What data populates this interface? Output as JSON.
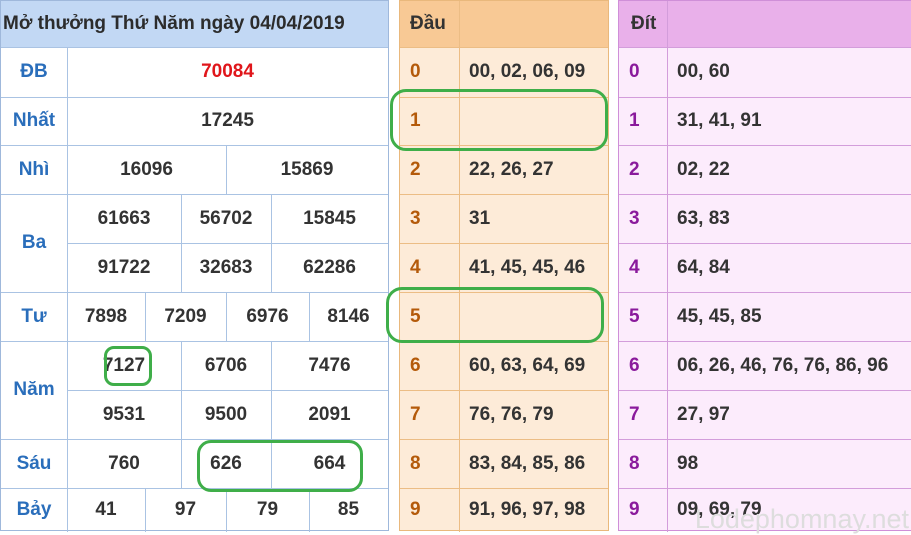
{
  "results": {
    "title": "Mở thưởng Thứ Năm ngày 04/04/2019",
    "rows": [
      {
        "label": "ĐB",
        "values": [
          "70084"
        ]
      },
      {
        "label": "Nhất",
        "values": [
          "17245"
        ]
      },
      {
        "label": "Nhì",
        "values": [
          "16096",
          "15869"
        ]
      },
      {
        "label": "Ba",
        "values": [
          "61663",
          "56702",
          "15845",
          "91722",
          "32683",
          "62286"
        ]
      },
      {
        "label": "Tư",
        "values": [
          "7898",
          "7209",
          "6976",
          "8146"
        ]
      },
      {
        "label": "Năm",
        "values": [
          "7127",
          "6706",
          "7476",
          "9531",
          "9500",
          "2091"
        ]
      },
      {
        "label": "Sáu",
        "values": [
          "760",
          "626",
          "664"
        ]
      },
      {
        "label": "Bảy",
        "values": [
          "41",
          "97",
          "79",
          "85"
        ]
      }
    ],
    "special_color": "#e0161b",
    "label_color": "#2a6ebb"
  },
  "dau": {
    "header": "Đầu",
    "rows": [
      {
        "digit": "0",
        "values": "00, 02, 06, 09"
      },
      {
        "digit": "1",
        "values": ""
      },
      {
        "digit": "2",
        "values": "22, 26, 27"
      },
      {
        "digit": "3",
        "values": "31"
      },
      {
        "digit": "4",
        "values": "41, 45, 45, 46"
      },
      {
        "digit": "5",
        "values": ""
      },
      {
        "digit": "6",
        "values": "60, 63, 64, 69"
      },
      {
        "digit": "7",
        "values": "76, 76, 79"
      },
      {
        "digit": "8",
        "values": "83, 84, 85, 86"
      },
      {
        "digit": "9",
        "values": "91, 96, 97, 98"
      }
    ],
    "digit_color": "#b45a0a"
  },
  "dit": {
    "header": "Đít",
    "rows": [
      {
        "digit": "0",
        "values": "00, 60"
      },
      {
        "digit": "1",
        "values": "31, 41, 91"
      },
      {
        "digit": "2",
        "values": "02, 22"
      },
      {
        "digit": "3",
        "values": "63, 83"
      },
      {
        "digit": "4",
        "values": "64, 84"
      },
      {
        "digit": "5",
        "values": "45, 45, 85"
      },
      {
        "digit": "6",
        "values": "06, 26, 46, 76, 76, 86, 96"
      },
      {
        "digit": "7",
        "values": "27, 97"
      },
      {
        "digit": "8",
        "values": "98"
      },
      {
        "digit": "9",
        "values": "09, 69, 79"
      }
    ],
    "digit_color": "#8a1a9c"
  },
  "watermark": "Lodephomnay.net"
}
